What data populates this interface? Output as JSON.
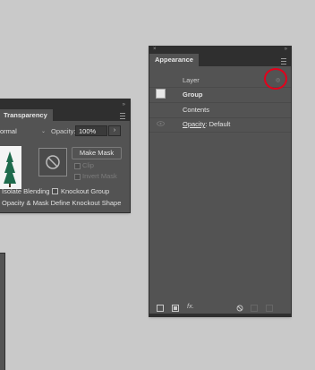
{
  "transparency": {
    "tab_label": "Transparency",
    "blend_mode": "ormal",
    "opacity_label": "Opacity:",
    "opacity_value": "100%",
    "make_mask_label": "Make Mask",
    "clip_label": "Clip",
    "invert_mask_label": "Invert Mask",
    "isolate_blending_label": "Isolate Blending",
    "knockout_group_label": "Knockout Group",
    "opacity_mask_label": "Opacity & Mask Define Knockout Shape"
  },
  "appearance": {
    "tab_label": "Appearance",
    "layer_label": "Layer",
    "group_label": "Group",
    "contents_label": "Contents",
    "opacity_label": "Opacity",
    "opacity_value": ": Default",
    "fx_label": "fx."
  },
  "colors": {
    "panel_bg": "#535353",
    "strip_bg": "#2f2f2f",
    "highlight_circle": "#e3001b",
    "canvas_bg": "#c9c9c9"
  }
}
